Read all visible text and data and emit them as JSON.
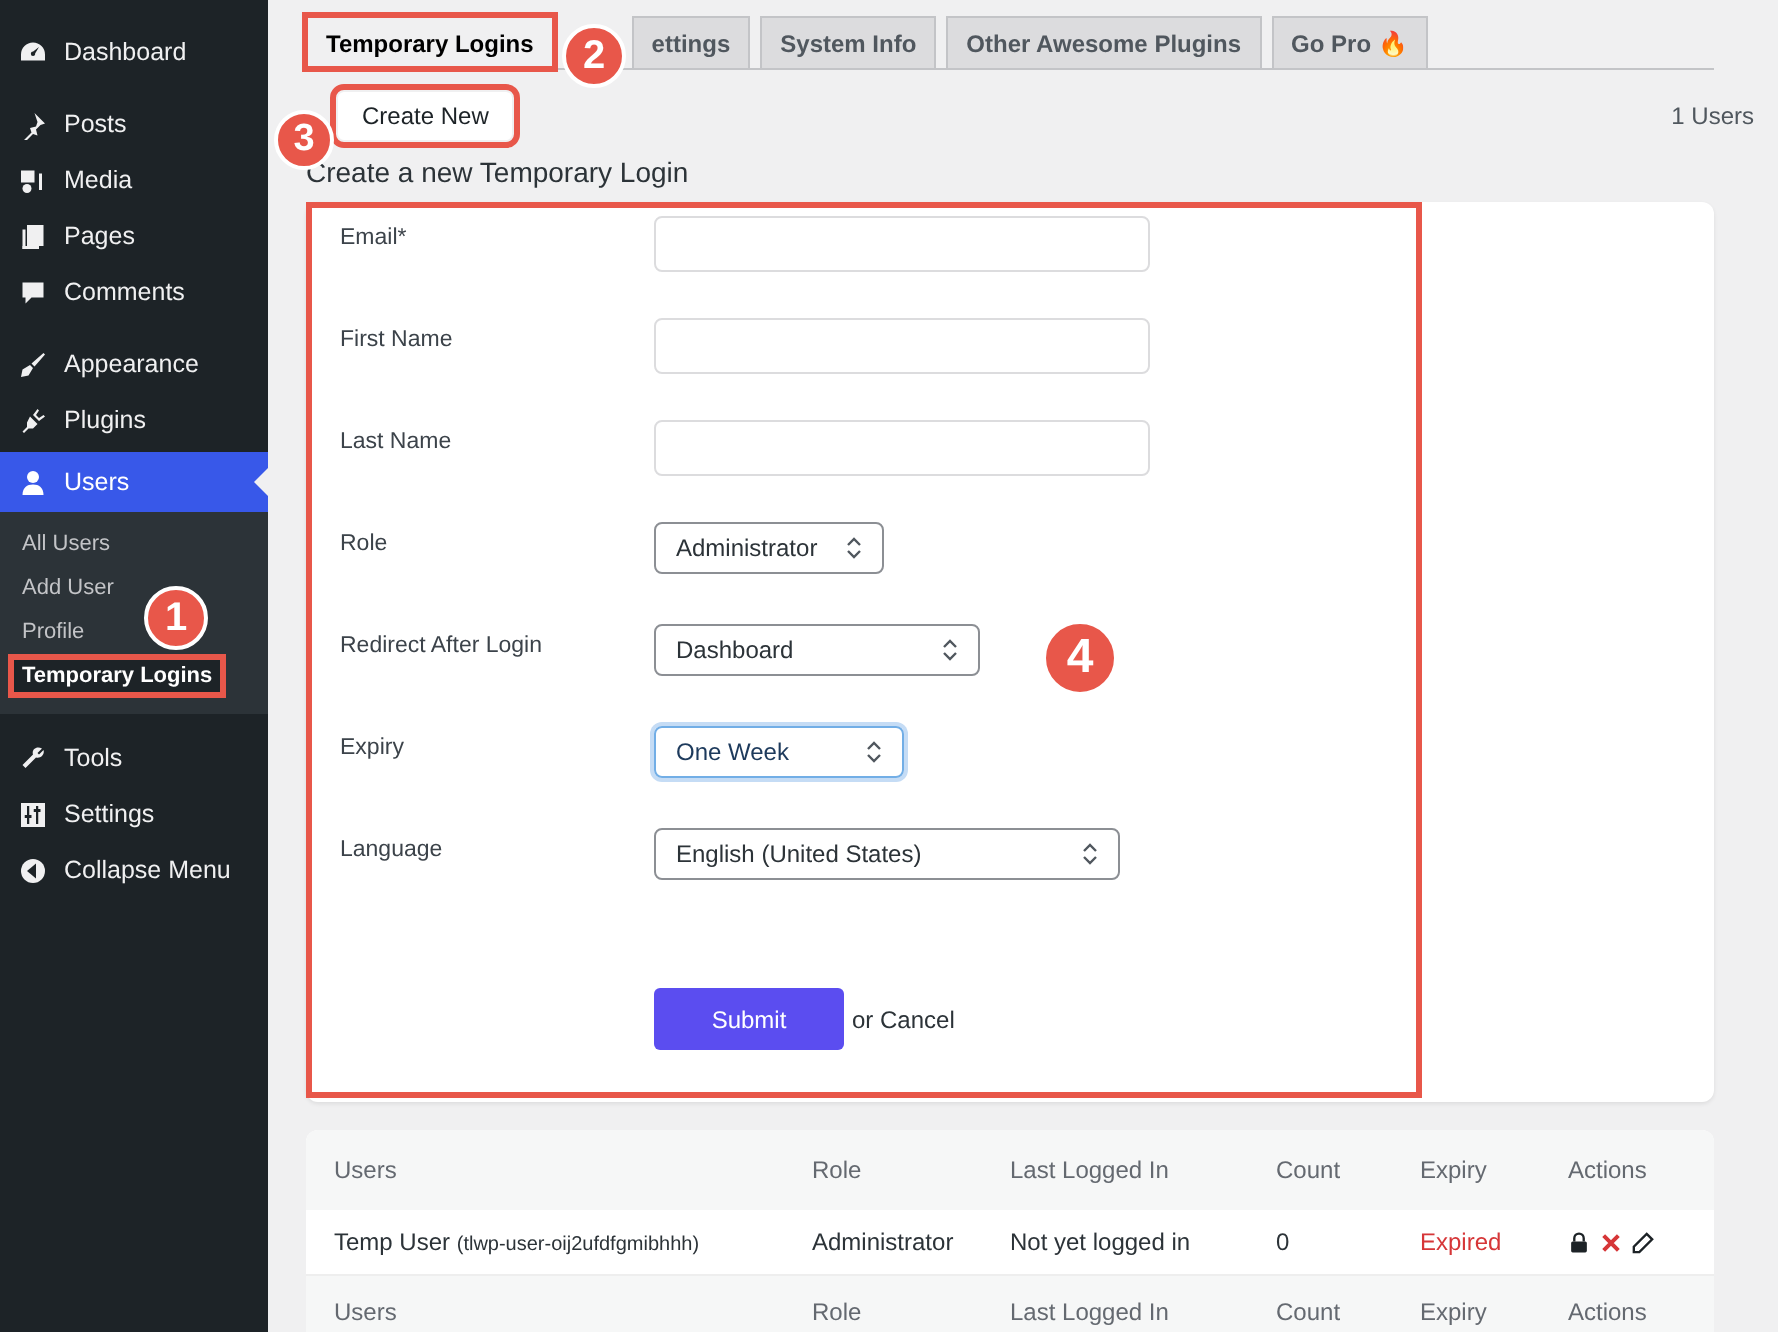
{
  "sidebar": {
    "items": [
      {
        "label": "Dashboard",
        "selected": false
      },
      {
        "label": "Posts",
        "selected": false
      },
      {
        "label": "Media",
        "selected": false
      },
      {
        "label": "Pages",
        "selected": false
      },
      {
        "label": "Comments",
        "selected": false
      },
      {
        "label": "Appearance",
        "selected": false
      },
      {
        "label": "Plugins",
        "selected": false
      },
      {
        "label": "Users",
        "selected": true,
        "children": [
          {
            "label": "All Users",
            "selected": false
          },
          {
            "label": "Add User",
            "selected": false
          },
          {
            "label": "Profile",
            "selected": false
          },
          {
            "label": "Temporary Logins",
            "selected": true
          }
        ]
      },
      {
        "label": "Tools",
        "selected": false
      },
      {
        "label": "Settings",
        "selected": false
      },
      {
        "label": "Collapse Menu",
        "selected": false
      }
    ]
  },
  "tabs": [
    {
      "label": "Temporary Logins",
      "selected": true
    },
    {
      "label": "ettings",
      "selected": false
    },
    {
      "label": "System Info",
      "selected": false
    },
    {
      "label": "Other Awesome Plugins",
      "selected": false
    },
    {
      "label": "Go Pro 🔥",
      "selected": false
    }
  ],
  "create_button": "Create New",
  "user_count": "1 Users",
  "heading": "Create a new Temporary Login",
  "form": {
    "fields": [
      {
        "label": "Email*",
        "kind": "text",
        "focused": false
      },
      {
        "label": "First Name",
        "kind": "text",
        "focused": false
      },
      {
        "label": "Last Name",
        "kind": "text",
        "focused": false
      },
      {
        "label": "Role",
        "kind": "select",
        "value": "Administrator",
        "focused": false
      },
      {
        "label": "Redirect After Login",
        "kind": "select",
        "value": "Dashboard",
        "focused": false
      },
      {
        "label": "Expiry",
        "kind": "select",
        "value": "One Week",
        "focused": true
      },
      {
        "label": "Language",
        "kind": "select",
        "value": "English (United States)",
        "focused": false
      }
    ],
    "submit": "Submit",
    "cancel": "or Cancel"
  },
  "table": {
    "columns": [
      "Users",
      "Role",
      "Last Logged In",
      "Count",
      "Expiry",
      "Actions"
    ],
    "rows": [
      {
        "name": "Temp User",
        "username": "(tlwp-user-oij2ufdfgmibhhh)",
        "role": "Administrator",
        "last_login": "Not yet logged in",
        "count": "0",
        "expiry": "Expired"
      }
    ],
    "footer": [
      "Users",
      "Role",
      "Last Logged In",
      "Count",
      "Expiry",
      "Actions"
    ]
  },
  "callouts": [
    "1",
    "2",
    "3",
    "4"
  ]
}
